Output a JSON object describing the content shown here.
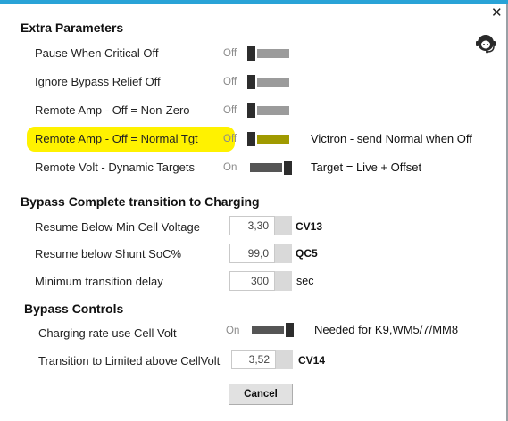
{
  "window": {
    "close_glyph": "✕",
    "support_icon": "headset-support-icon"
  },
  "extra": {
    "title": "Extra Parameters",
    "rows": [
      {
        "label": "Pause When Critical Off",
        "state": "Off",
        "on": false,
        "track_color": "#9b9b9b",
        "note": ""
      },
      {
        "label": "Ignore Bypass Relief Off",
        "state": "Off",
        "on": false,
        "track_color": "#9b9b9b",
        "note": ""
      },
      {
        "label": "Remote Amp - Off = Non-Zero",
        "state": "Off",
        "on": false,
        "track_color": "#9b9b9b",
        "note": ""
      },
      {
        "label": "Remote Amp - Off = Normal Tgt",
        "state": "Off",
        "on": false,
        "track_color": "#a09a00",
        "note": "Victron -  send Normal when Off",
        "highlighted": true
      },
      {
        "label": "Remote Volt - Dynamic Targets",
        "state": "On",
        "on": true,
        "track_color": "#555555",
        "note": "Target = Live + Offset"
      }
    ]
  },
  "bypass_transition": {
    "title": "Bypass Complete transition to Charging",
    "fields": [
      {
        "label": "Resume Below Min Cell Voltage",
        "value": "3,30",
        "code": "CV13"
      },
      {
        "label": "Resume below Shunt SoC%",
        "value": "99,0",
        "code": "QC5"
      },
      {
        "label": "Minimum transition delay",
        "value": "300",
        "unit": "sec"
      }
    ]
  },
  "bypass_controls": {
    "title": "Bypass Controls",
    "toggle_row": {
      "label": "Charging rate use Cell Volt",
      "state": "On",
      "on": true,
      "note": "Needed for K9,WM5/7/MM8"
    },
    "field": {
      "label": "Transition to Limited above CellVolt",
      "value": "3,52",
      "code": "CV14"
    }
  },
  "buttons": {
    "cancel": "Cancel"
  },
  "colors": {
    "accent": "#29a3d7",
    "highlight": "#fff200"
  }
}
